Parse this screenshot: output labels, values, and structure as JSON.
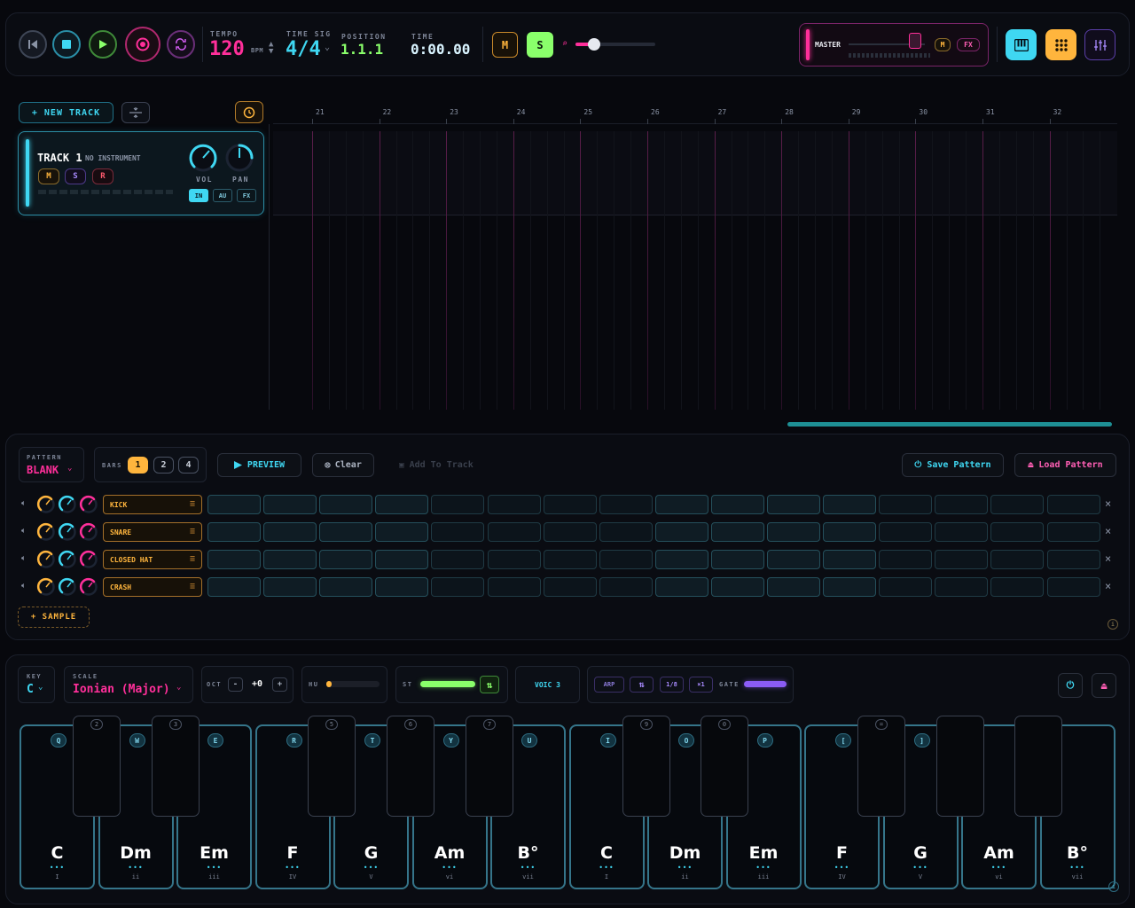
{
  "transport": {
    "tempo_label": "TEMPO",
    "tempo_value": "120",
    "bpm_label": "BPM",
    "timesig_label": "TIME SIG",
    "timesig_value": "4/4",
    "position_label": "POSITION",
    "position_value": "1.1.1",
    "time_label": "TIME",
    "time_value": "0:00.00",
    "mute_label": "M",
    "solo_label": "S",
    "zoom_level": 0.25
  },
  "master": {
    "label": "MASTER",
    "mute_label": "M",
    "fx_label": "FX",
    "fader_level": 0.8
  },
  "arrange": {
    "new_track_label": "+ NEW TRACK",
    "bar_numbers": [
      "21",
      "22",
      "23",
      "24",
      "25",
      "26",
      "27",
      "28",
      "29",
      "30",
      "31",
      "32"
    ],
    "scroll_position": 0.83
  },
  "track": {
    "name": "TRACK 1",
    "instrument": "NO INSTRUMENT",
    "mute": "M",
    "solo": "S",
    "record": "R",
    "vol_label": "VOL",
    "pan_label": "PAN",
    "in_label": "IN",
    "au_label": "AU",
    "fx_label": "FX"
  },
  "pattern": {
    "pattern_label": "PATTERN",
    "pattern_value": "BLANK",
    "bars_label": "BARS",
    "bars": [
      "1",
      "2",
      "4"
    ],
    "preview_label": "PREVIEW",
    "clear_label": "Clear",
    "add_label": "Add To Track",
    "save_label": "Save Pattern",
    "load_label": "Load Pattern",
    "add_sample_label": "+ SAMPLE",
    "rows": [
      {
        "name": "KICK"
      },
      {
        "name": "SNARE"
      },
      {
        "name": "CLOSED HAT"
      },
      {
        "name": "CRASH"
      }
    ],
    "remove_symbol": "×"
  },
  "keyboard": {
    "key_label": "KEY",
    "key_value": "C",
    "scale_label": "SCALE",
    "scale_value": "Ionian (Major)",
    "oct_label": "OCT",
    "oct_minus": "-",
    "oct_value": "+0",
    "oct_plus": "+",
    "hu_label": "HU",
    "st_label": "ST",
    "voic_label": "VOIC 3",
    "arp_label": "ARP",
    "arp_rate": "1/8",
    "arp_mult": "×1",
    "gate_label": "GATE",
    "white_keys": [
      {
        "chord": "C",
        "roman": "I",
        "key": "Q"
      },
      {
        "chord": "Dm",
        "roman": "ii",
        "key": "W"
      },
      {
        "chord": "Em",
        "roman": "iii",
        "key": "E"
      },
      {
        "chord": "F",
        "roman": "IV",
        "key": "R"
      },
      {
        "chord": "G",
        "roman": "V",
        "key": "T"
      },
      {
        "chord": "Am",
        "roman": "vi",
        "key": "Y"
      },
      {
        "chord": "B°",
        "roman": "vii",
        "key": "U"
      },
      {
        "chord": "C",
        "roman": "I",
        "key": "I"
      },
      {
        "chord": "Dm",
        "roman": "ii",
        "key": "O"
      },
      {
        "chord": "Em",
        "roman": "iii",
        "key": "P"
      },
      {
        "chord": "F",
        "roman": "IV",
        "key": "["
      },
      {
        "chord": "G",
        "roman": "V",
        "key": "]"
      },
      {
        "chord": "Am",
        "roman": "vi",
        "key": ""
      },
      {
        "chord": "B°",
        "roman": "vii",
        "key": ""
      }
    ],
    "black_keys": [
      "2",
      "3",
      "5",
      "6",
      "7",
      "9",
      "0",
      "=",
      "",
      ""
    ],
    "chord_dots": "•••"
  },
  "colors": {
    "cyan": "#3fd7f2",
    "pink": "#ff2f9a",
    "yellow": "#ffb53d",
    "green": "#8aff6b",
    "purple": "#8b5cf6"
  }
}
